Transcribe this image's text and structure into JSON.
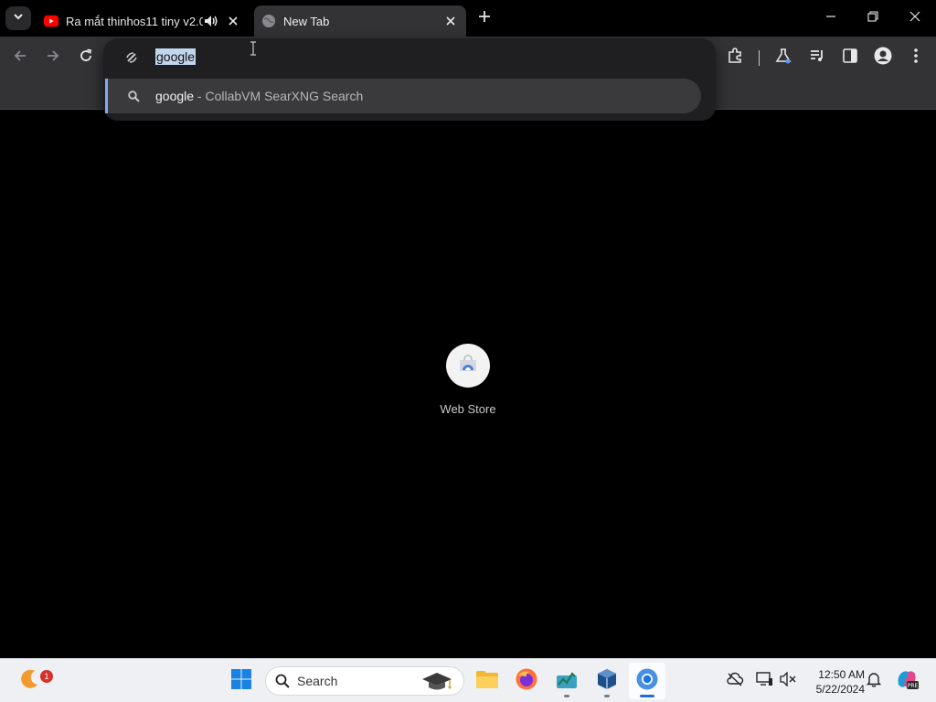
{
  "tabs": [
    {
      "title": "Ra mắt thinhos11 tiny v2.0",
      "favicon": "youtube-icon",
      "audio": true,
      "active": false
    },
    {
      "title": "New Tab",
      "favicon": "globe-icon",
      "active": true
    }
  ],
  "omnibox": {
    "value": "google",
    "suggestion_query": "google",
    "suggestion_desc": " - CollabVM SearXNG Search"
  },
  "ntp": {
    "shortcuts": [
      {
        "label": "Web Store"
      }
    ]
  },
  "taskbar": {
    "search_placeholder": "Search",
    "weather_badge": "1",
    "time": "12:50 AM",
    "date": "5/22/2024"
  },
  "colors": {
    "toolbar": "#333336",
    "omnibox_popup": "#1f1f22",
    "suggestion_accent": "#7cacf8",
    "taskbar": "#eef0f4"
  }
}
